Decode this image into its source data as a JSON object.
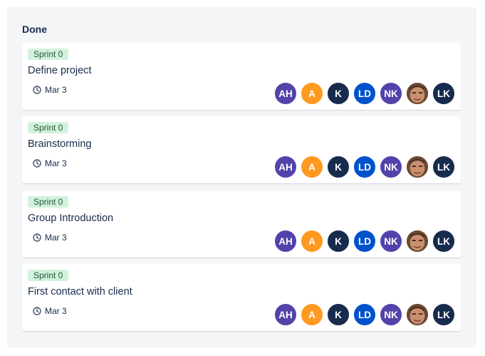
{
  "column": {
    "title": "Done"
  },
  "cards": [
    {
      "sprint": "Sprint 0",
      "title": "Define project",
      "due": "Mar 3"
    },
    {
      "sprint": "Sprint 0",
      "title": "Brainstorming",
      "due": "Mar 3"
    },
    {
      "sprint": "Sprint 0",
      "title": "Group Introduction",
      "due": "Mar 3"
    },
    {
      "sprint": "Sprint 0",
      "title": "First contact with client",
      "due": "Mar 3"
    }
  ],
  "assignees": [
    {
      "initials": "AH",
      "color": "#5243aa"
    },
    {
      "initials": "A",
      "color": "#ff991f"
    },
    {
      "initials": "K",
      "color": "#172b4d"
    },
    {
      "initials": "LD",
      "color": "#0052cc"
    },
    {
      "initials": "NK",
      "color": "#5243aa"
    },
    {
      "initials": "",
      "color": "#8a5a3c",
      "photo": true
    },
    {
      "initials": "LK",
      "color": "#172b4d"
    }
  ],
  "icons": {
    "due": "clock-icon"
  }
}
